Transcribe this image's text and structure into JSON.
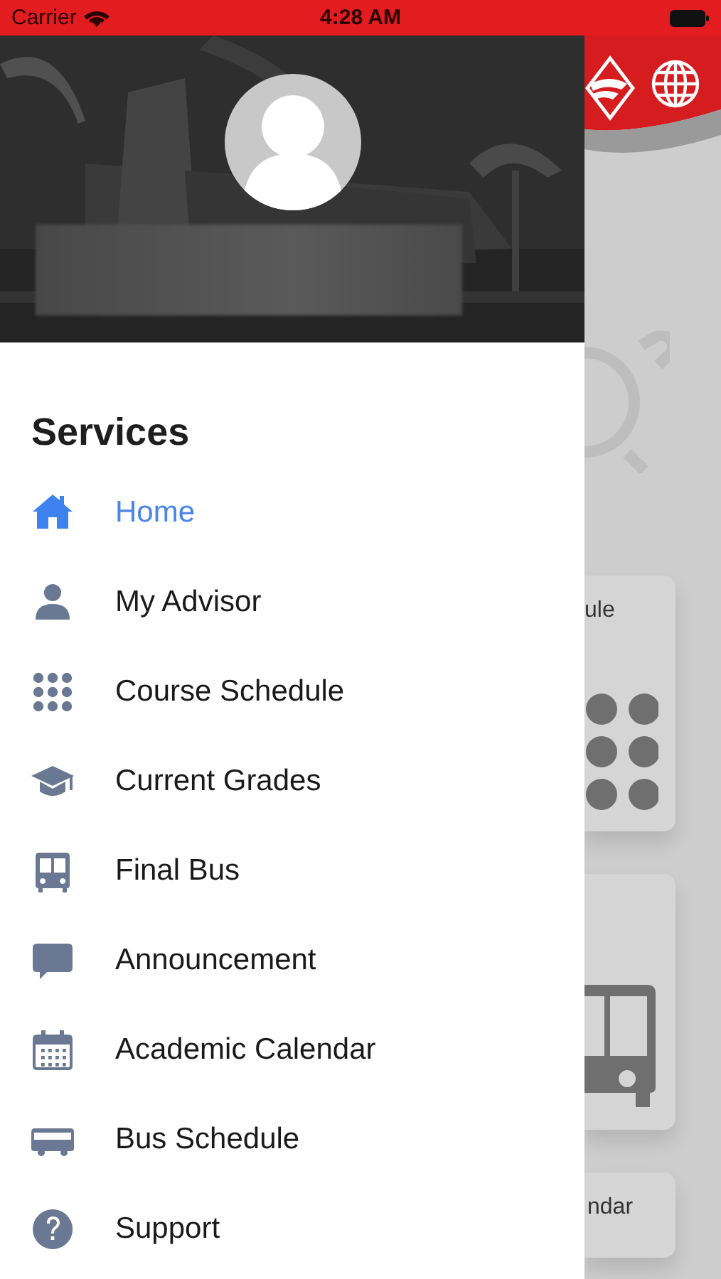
{
  "status_bar": {
    "carrier": "Carrier",
    "time": "4:28 AM"
  },
  "drawer": {
    "section_title": "Services",
    "items": [
      {
        "label": "Home",
        "kind": "home",
        "selected": true
      },
      {
        "label": "My Advisor",
        "kind": "person",
        "selected": false
      },
      {
        "label": "Course Schedule",
        "kind": "grid",
        "selected": false
      },
      {
        "label": "Current Grades",
        "kind": "cap",
        "selected": false
      },
      {
        "label": "Final Bus",
        "kind": "bus",
        "selected": false
      },
      {
        "label": "Announcement",
        "kind": "chat",
        "selected": false
      },
      {
        "label": "Academic Calendar",
        "kind": "calendar",
        "selected": false
      },
      {
        "label": "Bus Schedule",
        "kind": "coach",
        "selected": false
      },
      {
        "label": "Support",
        "kind": "help",
        "selected": false
      }
    ]
  },
  "background_screen": {
    "cards": [
      {
        "label": "ule",
        "kind": "dots"
      },
      {
        "kind": "bus"
      },
      {
        "label": "ndar",
        "kind": "plain"
      }
    ]
  }
}
